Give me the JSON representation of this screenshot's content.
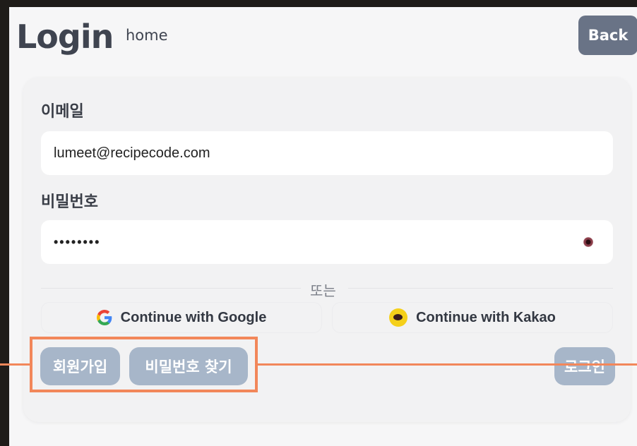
{
  "header": {
    "title": "Login",
    "home_link": "home",
    "back_label": "Back"
  },
  "form": {
    "email_label": "이메일",
    "email_value": "lumeet@recipecode.com",
    "password_label": "비밀번호",
    "password_value": "••••••••",
    "divider_text": "또는"
  },
  "social": {
    "google_label": "Continue with Google",
    "kakao_label": "Continue with Kakao"
  },
  "actions": {
    "signup_label": "회원가입",
    "find_password_label": "비밀번호 찾기",
    "login_label": "로그인"
  },
  "colors": {
    "primary_dark": "#697386",
    "disabled_button": "#a7b6c9",
    "highlight": "#f2875a",
    "kakao_yellow": "#f5d01a"
  },
  "icons": [
    "eye-icon",
    "google-icon",
    "kakao-icon"
  ]
}
